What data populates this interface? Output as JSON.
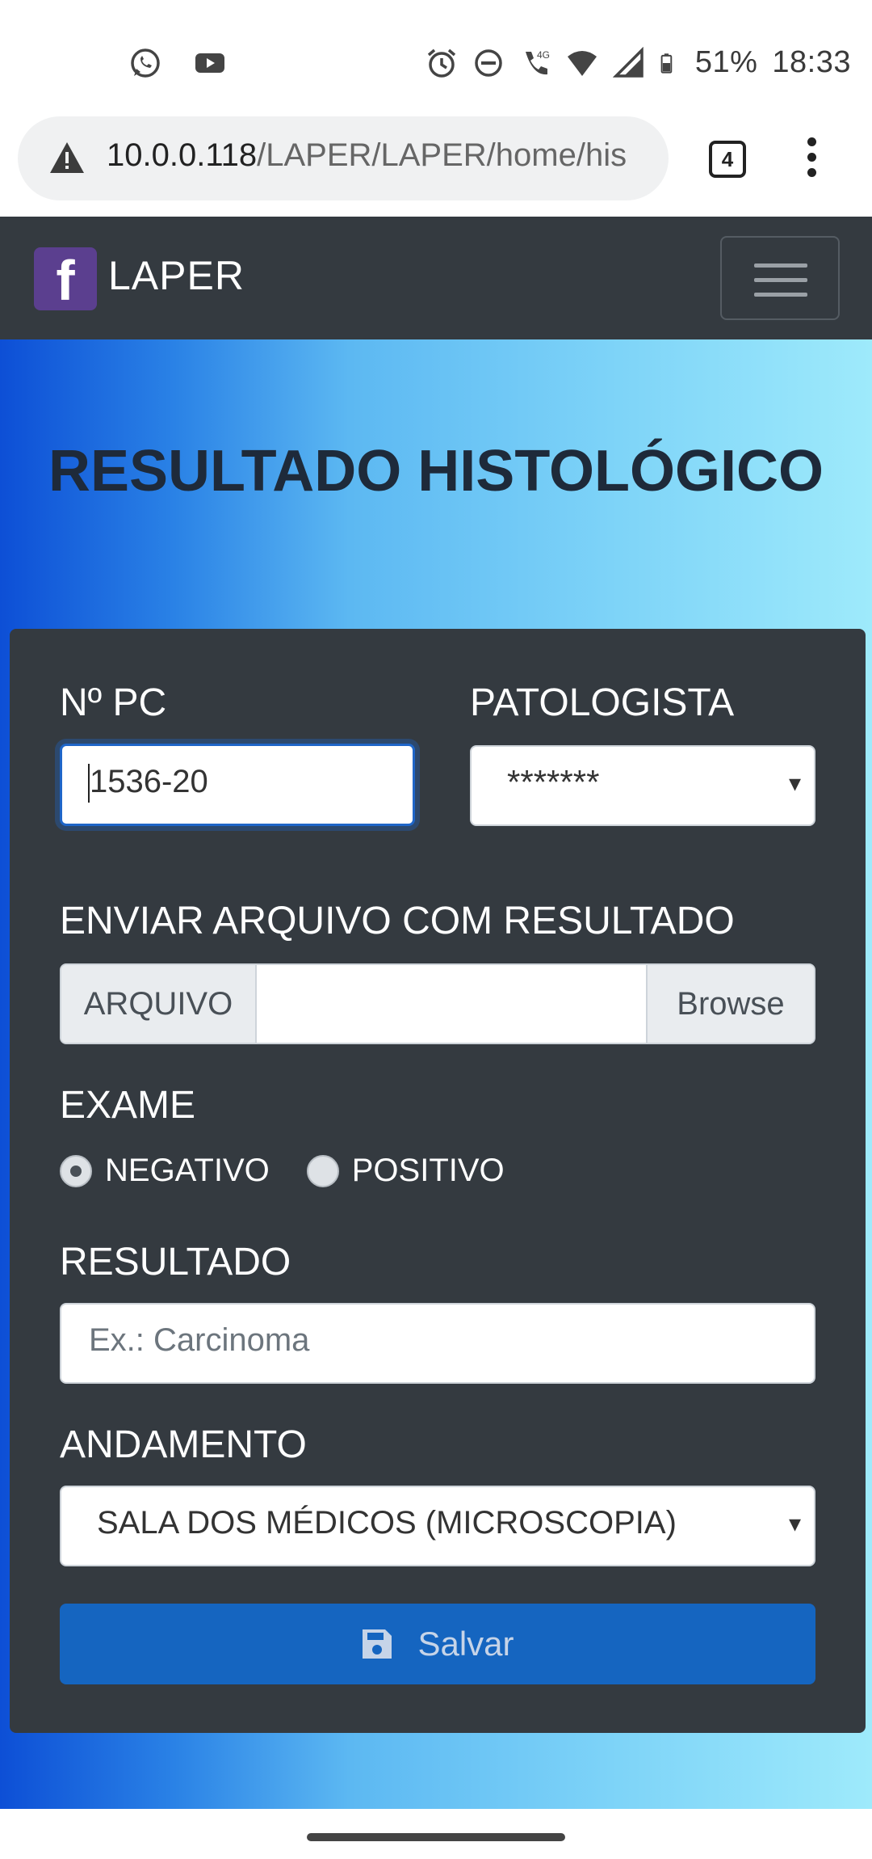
{
  "status_bar": {
    "battery": "51%",
    "time": "18:33",
    "icons": [
      "whatsapp-icon",
      "youtube-icon",
      "alarm-icon",
      "do-not-disturb-icon",
      "volte-call-icon",
      "wifi-icon",
      "signal-icon",
      "battery-icon"
    ]
  },
  "browser": {
    "url_host": "10.0.0.118",
    "url_path": "/LAPER/LAPER/home/his",
    "tab_count": "4"
  },
  "navbar": {
    "brand_logo": "f",
    "brand_name": "LAPER"
  },
  "page": {
    "title": "RESULTADO HISTOLÓGICO"
  },
  "form": {
    "pc_label": "Nº PC",
    "pc_value": "1536-20",
    "patologista_label": "PATOLOGISTA",
    "patologista_value": "*******",
    "file_label": "ENVIAR ARQUIVO COM RESULTADO",
    "file_prefix": "ARQUIVO",
    "file_browse": "Browse",
    "exame_label": "EXAME",
    "exame_options": [
      "NEGATIVO",
      "POSITIVO"
    ],
    "exame_selected": "NEGATIVO",
    "resultado_label": "RESULTADO",
    "resultado_placeholder": "Ex.: Carcinoma",
    "andamento_label": "ANDAMENTO",
    "andamento_value": "SALA DOS MÉDICOS (MICROSCOPIA)",
    "save_label": "Salvar"
  },
  "colors": {
    "navbar": "#343a40",
    "card": "#343a40",
    "brand_logo": "#5b3f8f",
    "save_button": "#1565c0",
    "gradient_start": "#0d4fd6",
    "gradient_end": "#9eeafb"
  }
}
